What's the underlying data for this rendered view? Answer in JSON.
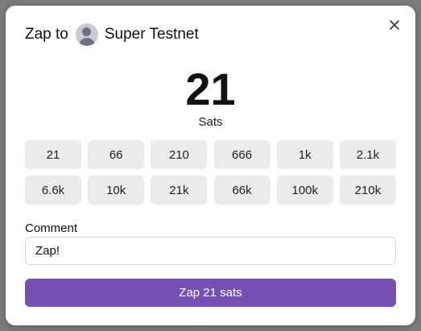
{
  "modal": {
    "title_prefix": "Zap to",
    "recipient_name": "Super Testnet",
    "amount": "21",
    "unit": "Sats",
    "presets": [
      "21",
      "66",
      "210",
      "666",
      "1k",
      "2.1k",
      "6.6k",
      "10k",
      "21k",
      "66k",
      "100k",
      "210k"
    ],
    "comment_label": "Comment",
    "comment_value": "Zap!",
    "submit_label": "Zap 21 sats"
  },
  "colors": {
    "accent": "#7551b3",
    "preset_bg": "#ebebeb"
  },
  "icons": {
    "close": "close-icon",
    "avatar": "user-avatar-icon"
  }
}
